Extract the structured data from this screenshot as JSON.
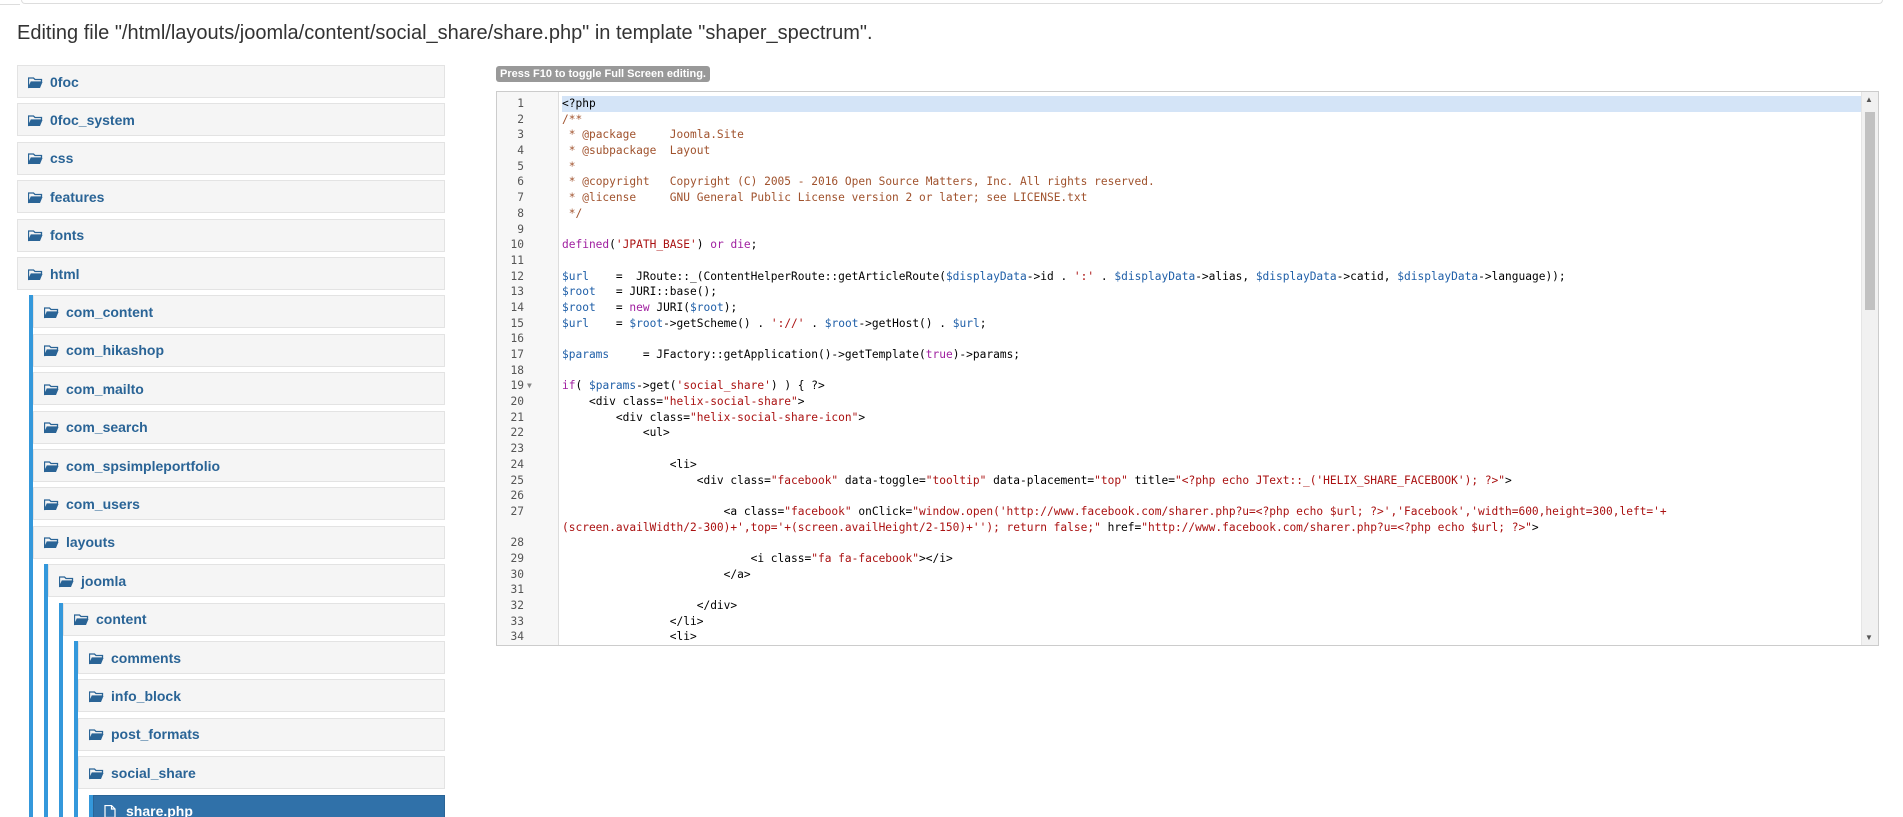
{
  "page": {
    "title": "Editing file \"/html/layouts/joomla/content/social_share/share.php\" in template \"shaper_spectrum\"."
  },
  "tree": {
    "items": [
      {
        "label": "0foc",
        "icon": "folder-open-icon"
      },
      {
        "label": "0foc_system",
        "icon": "folder-open-icon"
      },
      {
        "label": "css",
        "icon": "folder-open-icon"
      },
      {
        "label": "features",
        "icon": "folder-open-icon"
      },
      {
        "label": "fonts",
        "icon": "folder-open-icon"
      },
      {
        "label": "html",
        "icon": "folder-open-icon"
      },
      {
        "label": "com_content",
        "icon": "folder-open-icon"
      },
      {
        "label": "com_hikashop",
        "icon": "folder-open-icon"
      },
      {
        "label": "com_mailto",
        "icon": "folder-open-icon"
      },
      {
        "label": "com_search",
        "icon": "folder-open-icon"
      },
      {
        "label": "com_spsimpleportfolio",
        "icon": "folder-open-icon"
      },
      {
        "label": "com_users",
        "icon": "folder-open-icon"
      },
      {
        "label": "layouts",
        "icon": "folder-open-icon"
      },
      {
        "label": "joomla",
        "icon": "folder-open-icon"
      },
      {
        "label": "content",
        "icon": "folder-open-icon"
      },
      {
        "label": "comments",
        "icon": "folder-open-icon"
      },
      {
        "label": "info_block",
        "icon": "folder-open-icon"
      },
      {
        "label": "post_formats",
        "icon": "folder-open-icon"
      },
      {
        "label": "social_share",
        "icon": "folder-open-icon"
      },
      {
        "label": "share.php",
        "icon": "file-icon",
        "selected": true
      }
    ]
  },
  "editor": {
    "notice": "Press F10 to toggle Full Screen editing.",
    "lines": [
      {
        "n": "1",
        "text": "<?php"
      },
      {
        "n": "2",
        "text": "/**"
      },
      {
        "n": "3",
        "text": " * @package     Joomla.Site"
      },
      {
        "n": "4",
        "text": " * @subpackage  Layout"
      },
      {
        "n": "5",
        "text": " *"
      },
      {
        "n": "6",
        "text": " * @copyright   Copyright (C) 2005 - 2016 Open Source Matters, Inc. All rights reserved."
      },
      {
        "n": "7",
        "text": " * @license     GNU General Public License version 2 or later; see LICENSE.txt"
      },
      {
        "n": "8",
        "text": " */"
      },
      {
        "n": "9",
        "text": ""
      },
      {
        "n": "10",
        "text": "defined('JPATH_BASE') or die;"
      },
      {
        "n": "11",
        "text": ""
      },
      {
        "n": "12",
        "text": "$url    =  JRoute::_(ContentHelperRoute::getArticleRoute($displayData->id . ':' . $displayData->alias, $displayData->catid, $displayData->language));"
      },
      {
        "n": "13",
        "text": "$root   = JURI::base();"
      },
      {
        "n": "14",
        "text": "$root   = new JURI($root);"
      },
      {
        "n": "15",
        "text": "$url    = $root->getScheme() . '://' . $root->getHost() . $url;"
      },
      {
        "n": "16",
        "text": ""
      },
      {
        "n": "17",
        "text": "$params     = JFactory::getApplication()->getTemplate(true)->params;"
      },
      {
        "n": "18",
        "text": ""
      },
      {
        "n": "19",
        "text": "if( $params->get('social_share') ) { ?>"
      },
      {
        "n": "20",
        "text": "    <div class=\"helix-social-share\">"
      },
      {
        "n": "21",
        "text": "        <div class=\"helix-social-share-icon\">"
      },
      {
        "n": "22",
        "text": "            <ul>"
      },
      {
        "n": "23",
        "text": ""
      },
      {
        "n": "24",
        "text": "                <li>"
      },
      {
        "n": "25",
        "text": "                    <div class=\"facebook\" data-toggle=\"tooltip\" data-placement=\"top\" title=\"<?php echo JText::_('HELIX_SHARE_FACEBOOK'); ?>\">"
      },
      {
        "n": "26",
        "text": ""
      },
      {
        "n": "27",
        "text": "                        <a class=\"facebook\" onClick=\"window.open('http://www.facebook.com/sharer.php?u=<?php echo $url; ?>','Facebook','width=600,height=300,left='+\n(screen.availWidth/2-300)+',top='+(screen.availHeight/2-150)+''); return false;\" href=\"http://www.facebook.com/sharer.php?u=<?php echo $url; ?>\">"
      },
      {
        "n": "28",
        "text": ""
      },
      {
        "n": "29",
        "text": "                            <i class=\"fa fa-facebook\"></i>"
      },
      {
        "n": "30",
        "text": "                        </a>"
      },
      {
        "n": "31",
        "text": ""
      },
      {
        "n": "32",
        "text": "                    </div>"
      },
      {
        "n": "33",
        "text": "                </li>"
      },
      {
        "n": "34",
        "text": "                <li>"
      }
    ]
  },
  "colors": {
    "link": "#2a6496",
    "tree_border": "#3498db",
    "selected_bg": "#3071a9",
    "active_line": "#d4e4f7"
  }
}
